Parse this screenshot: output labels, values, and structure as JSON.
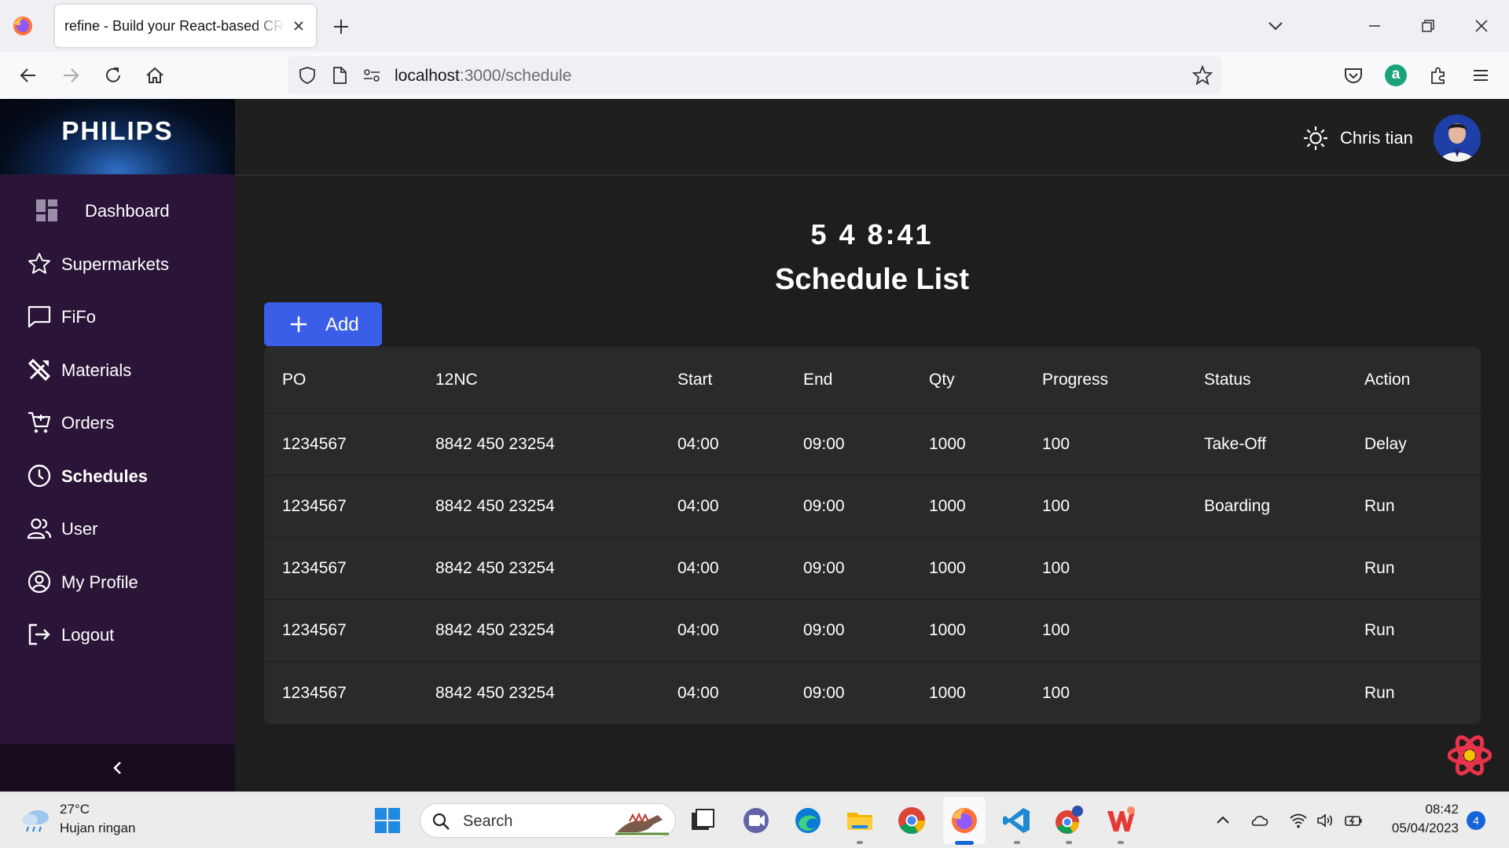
{
  "browser": {
    "tab_title": "refine - Build your React-based CRUD applications",
    "url_host": "localhost",
    "url_path": ":3000/schedule",
    "account_initial": "a"
  },
  "sidebar": {
    "brand": "PHILIPS",
    "items": [
      {
        "label": "Dashboard",
        "icon": "dashboard-icon"
      },
      {
        "label": "Supermarkets",
        "icon": "star-icon"
      },
      {
        "label": "FiFo",
        "icon": "chat-icon"
      },
      {
        "label": "Materials",
        "icon": "tools-icon"
      },
      {
        "label": "Orders",
        "icon": "cart-icon"
      },
      {
        "label": "Schedules",
        "icon": "clock-icon",
        "active": true
      },
      {
        "label": "User",
        "icon": "users-icon"
      },
      {
        "label": "My Profile",
        "icon": "profile-icon"
      },
      {
        "label": "Logout",
        "icon": "logout-icon"
      }
    ]
  },
  "header": {
    "user_name": "Chris tian"
  },
  "main": {
    "clock": "5 4 8:41",
    "title": "Schedule List",
    "add_label": "Add"
  },
  "table": {
    "columns": [
      "PO",
      "12NC",
      "Start",
      "End",
      "Qty",
      "Progress",
      "Status",
      "Action"
    ],
    "rows": [
      [
        "1234567",
        "8842 450 23254",
        "04:00",
        "09:00",
        "1000",
        "100",
        "Take-Off",
        "Delay"
      ],
      [
        "1234567",
        "8842 450 23254",
        "04:00",
        "09:00",
        "1000",
        "100",
        "Boarding",
        "Run"
      ],
      [
        "1234567",
        "8842 450 23254",
        "04:00",
        "09:00",
        "1000",
        "100",
        "",
        "Run"
      ],
      [
        "1234567",
        "8842 450 23254",
        "04:00",
        "09:00",
        "1000",
        "100",
        "",
        "Run"
      ],
      [
        "1234567",
        "8842 450 23254",
        "04:00",
        "09:00",
        "1000",
        "100",
        "",
        "Run"
      ]
    ]
  },
  "taskbar": {
    "weather_temp": "27°C",
    "weather_desc": "Hujan ringan",
    "search_label": "Search",
    "time": "08:42",
    "date": "05/04/2023",
    "notifications": "4"
  },
  "colors": {
    "sidebar_bg": "#2a1538",
    "accent": "#3b5ee8",
    "table_bg": "#2a2a2a",
    "page_bg": "#1e1e1e"
  }
}
